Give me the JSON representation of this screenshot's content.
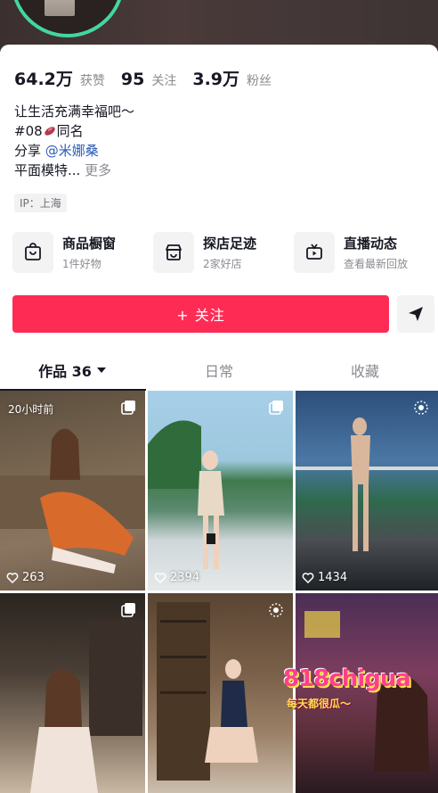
{
  "stats": {
    "likes": {
      "value": "64.2万",
      "label": "获赞"
    },
    "following": {
      "value": "95",
      "label": "关注"
    },
    "followers": {
      "value": "3.9万",
      "label": "粉丝"
    }
  },
  "bio": {
    "line1": "让生活充满幸福吧～",
    "line2_prefix": "#08",
    "line2_suffix": "同名",
    "line3_prefix": "分享",
    "line3_mention": "@米娜桑",
    "line4_text": "平面模特...",
    "line4_more": "更多"
  },
  "ip": "IP：上海",
  "shortcuts": [
    {
      "title": "商品橱窗",
      "subtitle": "1件好物",
      "icon": "shopping-bag-icon"
    },
    {
      "title": "探店足迹",
      "subtitle": "2家好店",
      "icon": "store-icon"
    },
    {
      "title": "直播动态",
      "subtitle": "查看最新回放",
      "icon": "tv-icon"
    }
  ],
  "follow_button": "+ 关注",
  "tabs": [
    {
      "label": "作品 36",
      "active": true
    },
    {
      "label": "日常",
      "active": false
    },
    {
      "label": "收藏",
      "active": false
    }
  ],
  "videos": [
    {
      "likes": "263",
      "time": "20小时前"
    },
    {
      "likes": "2394"
    },
    {
      "likes": "1434"
    },
    {
      "likes": ""
    },
    {
      "likes": ""
    },
    {
      "likes": ""
    }
  ],
  "watermark": {
    "main": "818chigua",
    "sub": "每天都很瓜～"
  },
  "colors": {
    "accent": "#fe2c55",
    "ring": "#43d6a0",
    "mention": "#2a5db8"
  }
}
